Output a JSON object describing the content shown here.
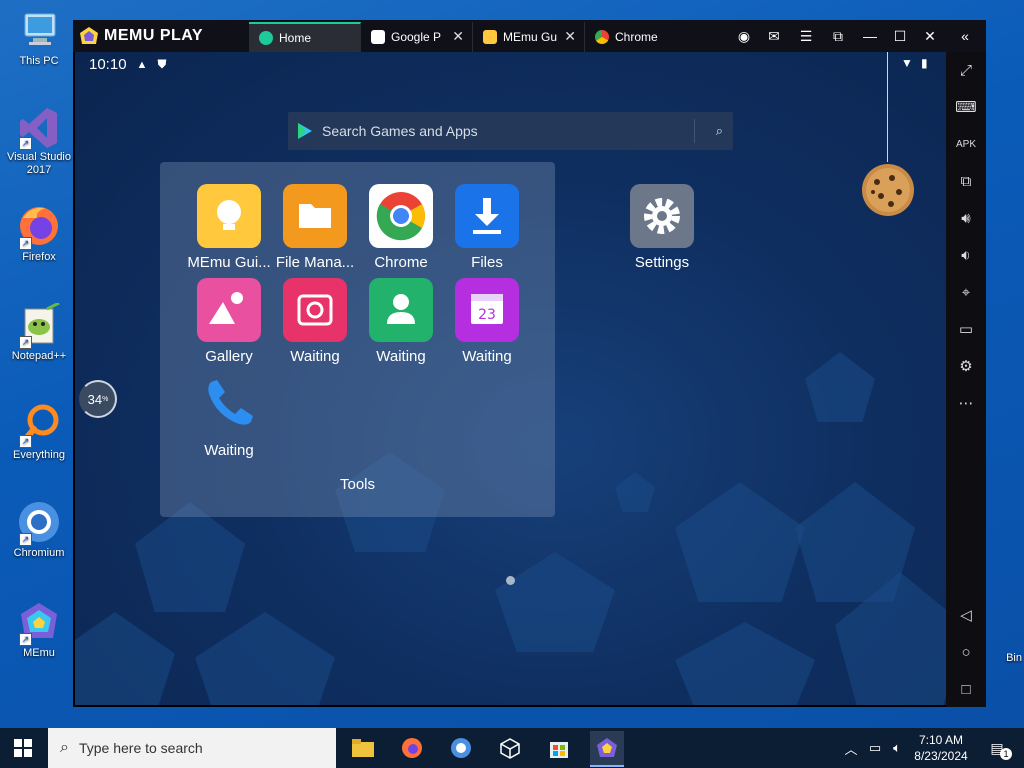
{
  "desktop": {
    "icons": [
      {
        "label": "This PC"
      },
      {
        "label": "Visual Studio 2017"
      },
      {
        "label": "Firefox"
      },
      {
        "label": "Notepad++"
      },
      {
        "label": "Everything"
      },
      {
        "label": "Chromium"
      },
      {
        "label": "MEmu"
      },
      {
        "label": "Bin"
      }
    ]
  },
  "window": {
    "brand": "MEMU PLAY",
    "tabs": [
      {
        "label": "Home",
        "active": true
      },
      {
        "label": "Google P"
      },
      {
        "label": "MEmu Gu"
      },
      {
        "label": "Chrome"
      }
    ]
  },
  "android": {
    "time": "10:10",
    "search_placeholder": "Search Games and Apps",
    "progress_percent": "34",
    "folder": {
      "title": "Tools",
      "apps": [
        {
          "label": "MEmu Gui..."
        },
        {
          "label": "File Mana..."
        },
        {
          "label": "Chrome"
        },
        {
          "label": "Files"
        },
        {
          "label": "Gallery"
        },
        {
          "label": "Waiting"
        },
        {
          "label": "Waiting"
        },
        {
          "label": "Waiting"
        },
        {
          "label": "Waiting"
        }
      ]
    },
    "settings_label": "Settings",
    "calendar_day": "23"
  },
  "taskbar": {
    "search_placeholder": "Type here to search",
    "time": "7:10 AM",
    "date": "8/23/2024",
    "notification_count": "1"
  }
}
